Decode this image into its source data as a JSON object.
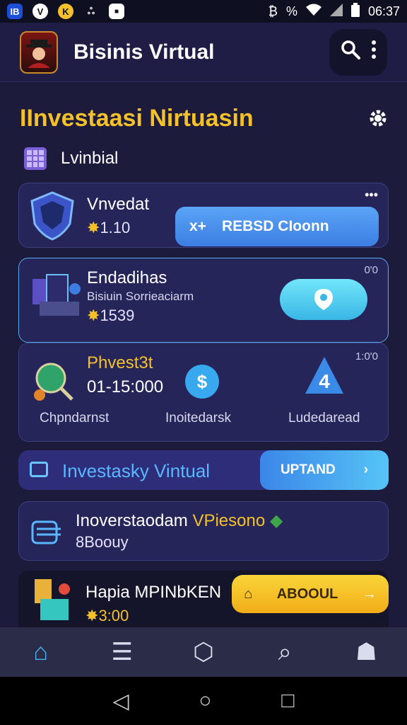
{
  "status_bar": {
    "app_icons": [
      "IB",
      "V",
      "K",
      "ஃ",
      "■"
    ],
    "right_icons": [
      "₿",
      "%"
    ],
    "time": "06:37"
  },
  "app_bar": {
    "title": "Bisinis Virtual",
    "logo_icon": "investor-avatar-icon",
    "search_icon": "search-icon",
    "menu_icon": "more-vertical-icon"
  },
  "section": {
    "title": "IInvestaasi Nirtuasin",
    "subtitle": "Lvinbial"
  },
  "cards": [
    {
      "title": "Vnvedat",
      "value": "1.10",
      "menu": "•••",
      "button_label": "REBSD CIoonn",
      "button_icon": "x+"
    },
    {
      "title": "Endadihas",
      "subtitle": "Bisiuin Sorrieaciarm",
      "value": "1539",
      "corner": "0'0"
    },
    {
      "title": "Phvest3t",
      "value": "01-15:000",
      "corner": "1:0'0",
      "columns": [
        "Chpndarnst",
        "Inoitedarsk",
        "Ludedaread"
      ]
    }
  ],
  "banner": {
    "label": "Investasky Vintual",
    "button_label": "UPTAND",
    "button_arrow": "›"
  },
  "list_item": {
    "title_a": "Inoverstaodam",
    "title_b": "VPiesono",
    "subtitle": "8Boouy"
  },
  "promo": {
    "title": "Hapia MPINbKEN",
    "value": "3:00",
    "button_label": "ABOOUL",
    "button_arrow": "→"
  },
  "bottom_nav": [
    {
      "name": "home",
      "icon": "⌂"
    },
    {
      "name": "list",
      "icon": "☰"
    },
    {
      "name": "box",
      "icon": "⬡"
    },
    {
      "name": "search",
      "icon": "⌕"
    },
    {
      "name": "profile",
      "icon": "☗"
    }
  ],
  "system_nav": {
    "back": "◁",
    "home": "○",
    "recents": "□"
  },
  "colors": {
    "accent_yellow": "#f5c12b",
    "accent_blue": "#4ab3f2",
    "background": "#1c1b3c"
  }
}
